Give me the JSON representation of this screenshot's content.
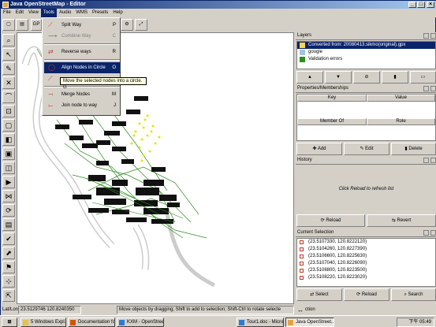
{
  "window": {
    "title": "Java OpenStreetMap - Editor"
  },
  "menubar": [
    "File",
    "Edit",
    "View",
    "Tools",
    "Audio",
    "WMS",
    "Presets",
    "Help"
  ],
  "tools_menu": [
    {
      "label": "Split Way",
      "accel": "P",
      "disabled": false,
      "icon": "split-way-icon"
    },
    {
      "label": "Combine Way",
      "accel": "C",
      "disabled": true,
      "icon": "combine-way-icon"
    },
    {
      "sep": true
    },
    {
      "label": "Reverse ways",
      "accel": "R",
      "disabled": false,
      "icon": "reverse-ways-icon"
    },
    {
      "sep": true
    },
    {
      "label": "Align Nodes in Circle",
      "accel": "O",
      "disabled": false,
      "highlighted": true,
      "icon": "align-circle-icon"
    },
    {
      "label": "",
      "accel": "",
      "disabled": false,
      "icon": "align-line-icon"
    },
    {
      "sep": true
    },
    {
      "label": "Merge Nodes",
      "accel": "M",
      "disabled": false,
      "icon": "merge-nodes-icon"
    },
    {
      "label": "Join node to way",
      "accel": "J",
      "disabled": false,
      "icon": "join-node-icon"
    }
  ],
  "tooltip": "Move the selected nodes into a circle. G",
  "toolbar_label": "GP",
  "layers": {
    "title": "Layers",
    "items": [
      {
        "label": "Converted from: 20080413.sikmo(original).gpx",
        "selected": true
      },
      {
        "label": "google",
        "selected": false
      },
      {
        "label": "Validation errors",
        "selected": false
      }
    ]
  },
  "properties": {
    "title": "Properties/Memberships",
    "cols": [
      "Key",
      "Value"
    ],
    "member_cols": [
      "Member Of",
      "Role"
    ],
    "buttons": [
      "Add",
      "Edit",
      "Delete"
    ]
  },
  "history": {
    "title": "History",
    "message": "Click Reload to refresh list",
    "buttons": [
      "Reload",
      "Revert"
    ]
  },
  "selection": {
    "title": "Current Selection",
    "items": [
      "(23.5107330, 120.8222120)",
      "(23.5104260, 120.8227390)",
      "(23.5106600, 120.8225630)",
      "(23.5107040, 120.8226090)",
      "(23.5108800, 120.8223500)",
      "(23.5108220, 120.8223020)"
    ],
    "buttons": [
      "Select",
      "Reload",
      "Search"
    ]
  },
  "status": {
    "latlon_label": "Lat/Lon",
    "latlon": "23.5129746 120.8240350",
    "hint": "Move objects by dragging; Shift to add to selection; Shift-Ctrl to rotate selecte",
    "tail": "ction"
  },
  "taskbar": {
    "start": "",
    "tasks": [
      "5 Windows Expl...",
      "Documentation fo...",
      "KXM - OpenStree...",
      "Tour1.doc - Micro...",
      "Java OpenStreet..."
    ],
    "clock": "下午 05:49"
  },
  "colors": {
    "title_start": "#0a246a",
    "title_end": "#a6caf0",
    "track": "#2e8b22",
    "points": "#e6e600",
    "highlight": "#0a246a"
  }
}
